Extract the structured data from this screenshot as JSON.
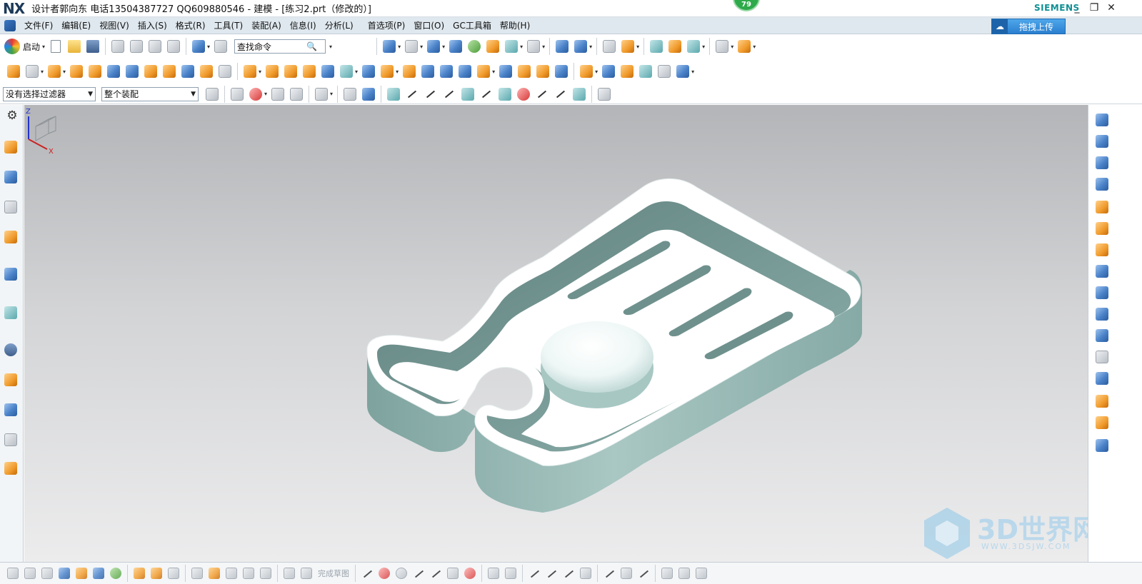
{
  "window": {
    "logo": "NX",
    "title": "设计者郭向东  电话13504387727  QQ609880546 - 建模 - [练习2.prt（修改的）]",
    "badge": "79",
    "brand": "SIEMENS",
    "min": "_",
    "restore": "❐",
    "close": "✕"
  },
  "menu": {
    "items": [
      "文件(F)",
      "编辑(E)",
      "视图(V)",
      "插入(S)",
      "格式(R)",
      "工具(T)",
      "装配(A)",
      "信息(I)",
      "分析(L)",
      "首选项(P)",
      "窗口(O)",
      "GC工具箱",
      "帮助(H)"
    ],
    "upload_label": "拖拽上传",
    "upload_icon": "cloud-icon"
  },
  "toolbar1": {
    "start_label": "启动",
    "search_placeholder": "查找命令",
    "search_value": "查找命令"
  },
  "toolbar3": {
    "filter_value": "没有选择过滤器",
    "scope_value": "整个装配"
  },
  "bottombar": {
    "faded_label": "完成草图"
  },
  "triad": {
    "z": "Z",
    "x": "X"
  },
  "watermark": {
    "text": "3D世界网",
    "sub": "WWW.3DSJW.COM"
  },
  "colors": {
    "accent": "#0f8f93",
    "menu_bg": "#dfe8ee",
    "viewport_top": "#b3b5b8",
    "viewport_bottom": "#ececed",
    "model_wall": "#8fb5b1",
    "model_top": "#ffffff"
  }
}
